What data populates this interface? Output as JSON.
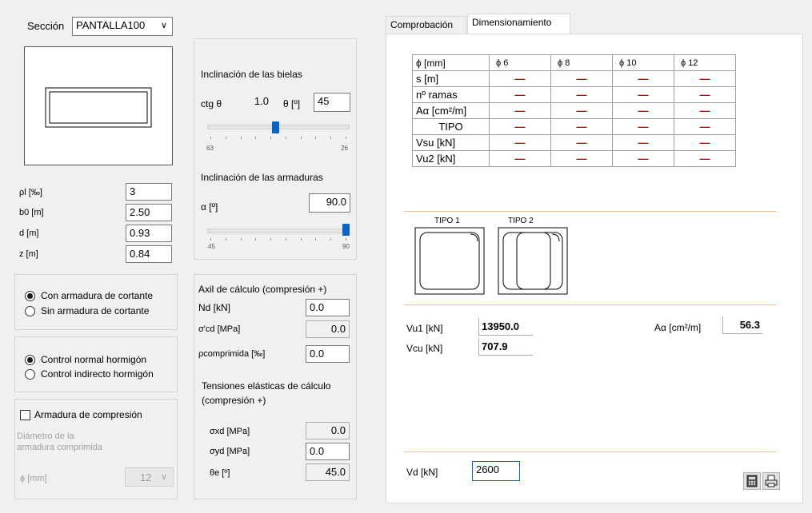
{
  "section": {
    "label": "Sección",
    "value": "PANTALLA100"
  },
  "props": [
    {
      "label": "ρl [‰]",
      "value": "3"
    },
    {
      "label": "b0 [m]",
      "value": "2.50"
    },
    {
      "label": "d [m]",
      "value": "0.93"
    },
    {
      "label": "z [m]",
      "value": "0.84"
    }
  ],
  "shear_radio": {
    "opt1": "Con armadura de cortante",
    "opt2": "Sin armadura de cortante"
  },
  "control_radio": {
    "opt1": "Control normal hormigón",
    "opt2": "Control indirecto hormigón"
  },
  "compression": {
    "label": "Armadura de compresión",
    "diam_label_1": "Diámetro de la",
    "diam_label_2": "armadura comprimida",
    "phi_label": "ϕ  [mm]",
    "phi_value": "12"
  },
  "struts": {
    "title": "Inclinación de las bielas",
    "ctg_label": "ctg θ",
    "ctg_value": "1.0",
    "theta_label": "θ [º]",
    "theta_value": "45",
    "slider_min": "63",
    "slider_max": "26",
    "slider_level": 0.48
  },
  "rebar_incl": {
    "title": "Inclinación de las armaduras",
    "alpha_label": "α [º]",
    "alpha_value": "90.0",
    "slider_min": "45",
    "slider_max": "90",
    "slider_level": 1.0
  },
  "axial": {
    "title": "Axil de cálculo (compresión +)",
    "nd_label": "Nd [kN]",
    "nd_value": "0.0",
    "scd_label": "σ'cd  [MPa]",
    "scd_value": "0.0",
    "rho_label": "ρcomprimida [‰]",
    "rho_value": "0.0",
    "tens_title_1": "Tensiones elásticas de cálculo",
    "tens_title_2": "(compresión +)",
    "sxd_label": "σxd  [MPa]",
    "sxd_value": "0.0",
    "syd_label": "σyd  [MPa]",
    "syd_value": "0.0",
    "thetae_label": "θe   [º]",
    "thetae_value": "45.0"
  },
  "tabs": {
    "tab1": "Comprobación",
    "tab2": "Dimensionamiento"
  },
  "table": {
    "header": [
      "ϕ  [mm]",
      "ϕ 6",
      "ϕ 8",
      "ϕ 10",
      "ϕ 12"
    ],
    "rows": [
      {
        "label": "s [m]"
      },
      {
        "label": "nº ramas"
      },
      {
        "label": "Aα [cm²/m]"
      },
      {
        "label": "TIPO"
      },
      {
        "label": "Vsu [kN]"
      },
      {
        "label": "Vu2 [kN]"
      }
    ],
    "dash": "—"
  },
  "types": {
    "t1": "TIPO 1",
    "t2": "TIPO 2"
  },
  "results": {
    "vu1_label": "Vu1 [kN]",
    "vu1_value": "13950.0",
    "vcu_label": "Vcu [kN]",
    "vcu_value": "707.9",
    "aa_label": "Aα  [cm²/m]",
    "aa_value": "56.3"
  },
  "vd": {
    "label": "Vd  [kN]",
    "value": "2600"
  },
  "buttons": {
    "calc_icon": "calculator-icon",
    "print_icon": "printer-icon"
  }
}
